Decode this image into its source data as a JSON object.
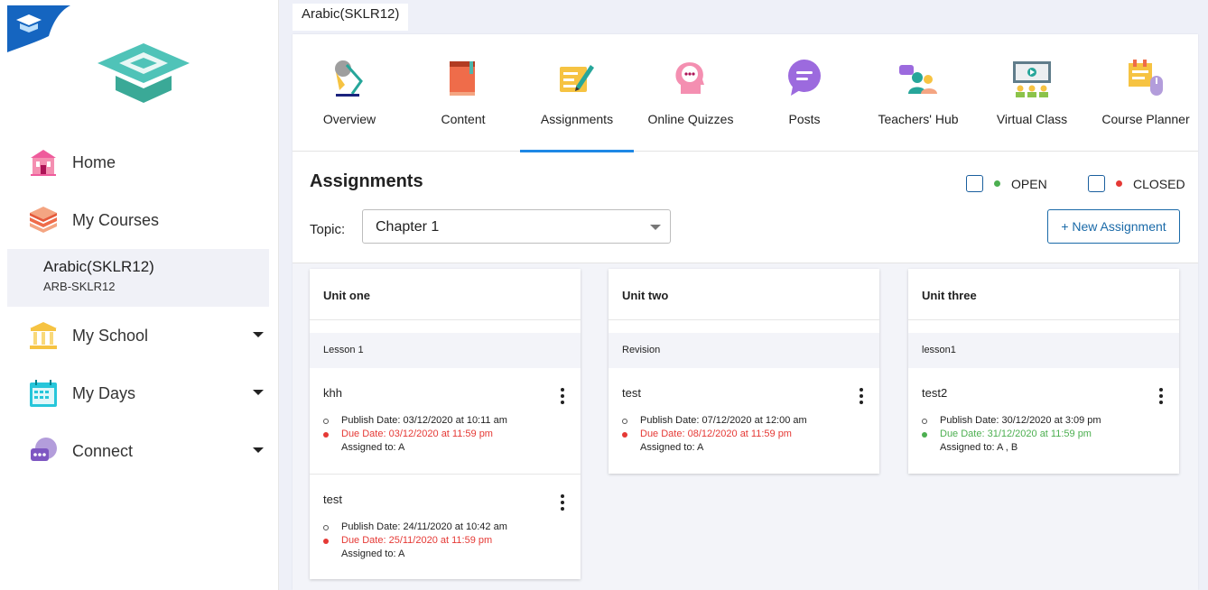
{
  "sidebar": {
    "nav": [
      {
        "label": "Home",
        "icon": "home-icon"
      },
      {
        "label": "My Courses",
        "icon": "books-icon"
      },
      {
        "label": "My School",
        "icon": "school-icon"
      },
      {
        "label": "My Days",
        "icon": "calendar-icon"
      },
      {
        "label": "Connect",
        "icon": "chat-icon"
      }
    ],
    "current_course": {
      "name": "Arabic(SKLR12)",
      "code": "ARB-SKLR12"
    }
  },
  "breadcrumb": {
    "course_tab": "Arabic(SKLR12)"
  },
  "tabs": [
    {
      "label": "Overview",
      "icon": "desk-lamp-icon"
    },
    {
      "label": "Content",
      "icon": "book-icon"
    },
    {
      "label": "Assignments",
      "icon": "assignment-pen-icon",
      "active": true
    },
    {
      "label": "Online Quizzes",
      "icon": "head-chat-icon"
    },
    {
      "label": "Posts",
      "icon": "speech-bubble-icon"
    },
    {
      "label": "Teachers' Hub",
      "icon": "teachers-group-icon"
    },
    {
      "label": "Virtual Class",
      "icon": "screen-class-icon"
    },
    {
      "label": "Course Planner",
      "icon": "planner-mouse-icon"
    }
  ],
  "assignments": {
    "title": "Assignments",
    "filters": [
      {
        "label": "OPEN",
        "color": "#4caf50"
      },
      {
        "label": "CLOSED",
        "color": "#e53935"
      }
    ],
    "topic_label": "Topic:",
    "topic_value": "Chapter 1",
    "new_button": "+ New Assignment"
  },
  "units": [
    {
      "title": "Unit one",
      "lesson": "Lesson 1",
      "items": [
        {
          "name": "khh",
          "publish": "Publish Date: 03/12/2020 at 10:11 am",
          "due": "Due Date: 03/12/2020 at 11:59 pm",
          "due_color": "#e53935",
          "assigned": "Assigned to: A"
        },
        {
          "name": "test",
          "publish": "Publish Date: 24/11/2020 at 10:42 am",
          "due": "Due Date: 25/11/2020 at 11:59 pm",
          "due_color": "#e53935",
          "assigned": "Assigned to: A"
        }
      ]
    },
    {
      "title": "Unit two",
      "lesson": "Revision",
      "items": [
        {
          "name": "test",
          "publish": "Publish Date: 07/12/2020 at 12:00 am",
          "due": "Due Date: 08/12/2020 at 11:59 pm",
          "due_color": "#e53935",
          "assigned": "Assigned to: A"
        }
      ]
    },
    {
      "title": "Unit three",
      "lesson": "lesson1",
      "items": [
        {
          "name": "test2",
          "publish": "Publish Date: 30/12/2020 at 3:09 pm",
          "due": "Due Date: 31/12/2020 at 11:59 pm",
          "due_color": "#4caf50",
          "assigned": "Assigned to: A , B"
        }
      ]
    }
  ]
}
